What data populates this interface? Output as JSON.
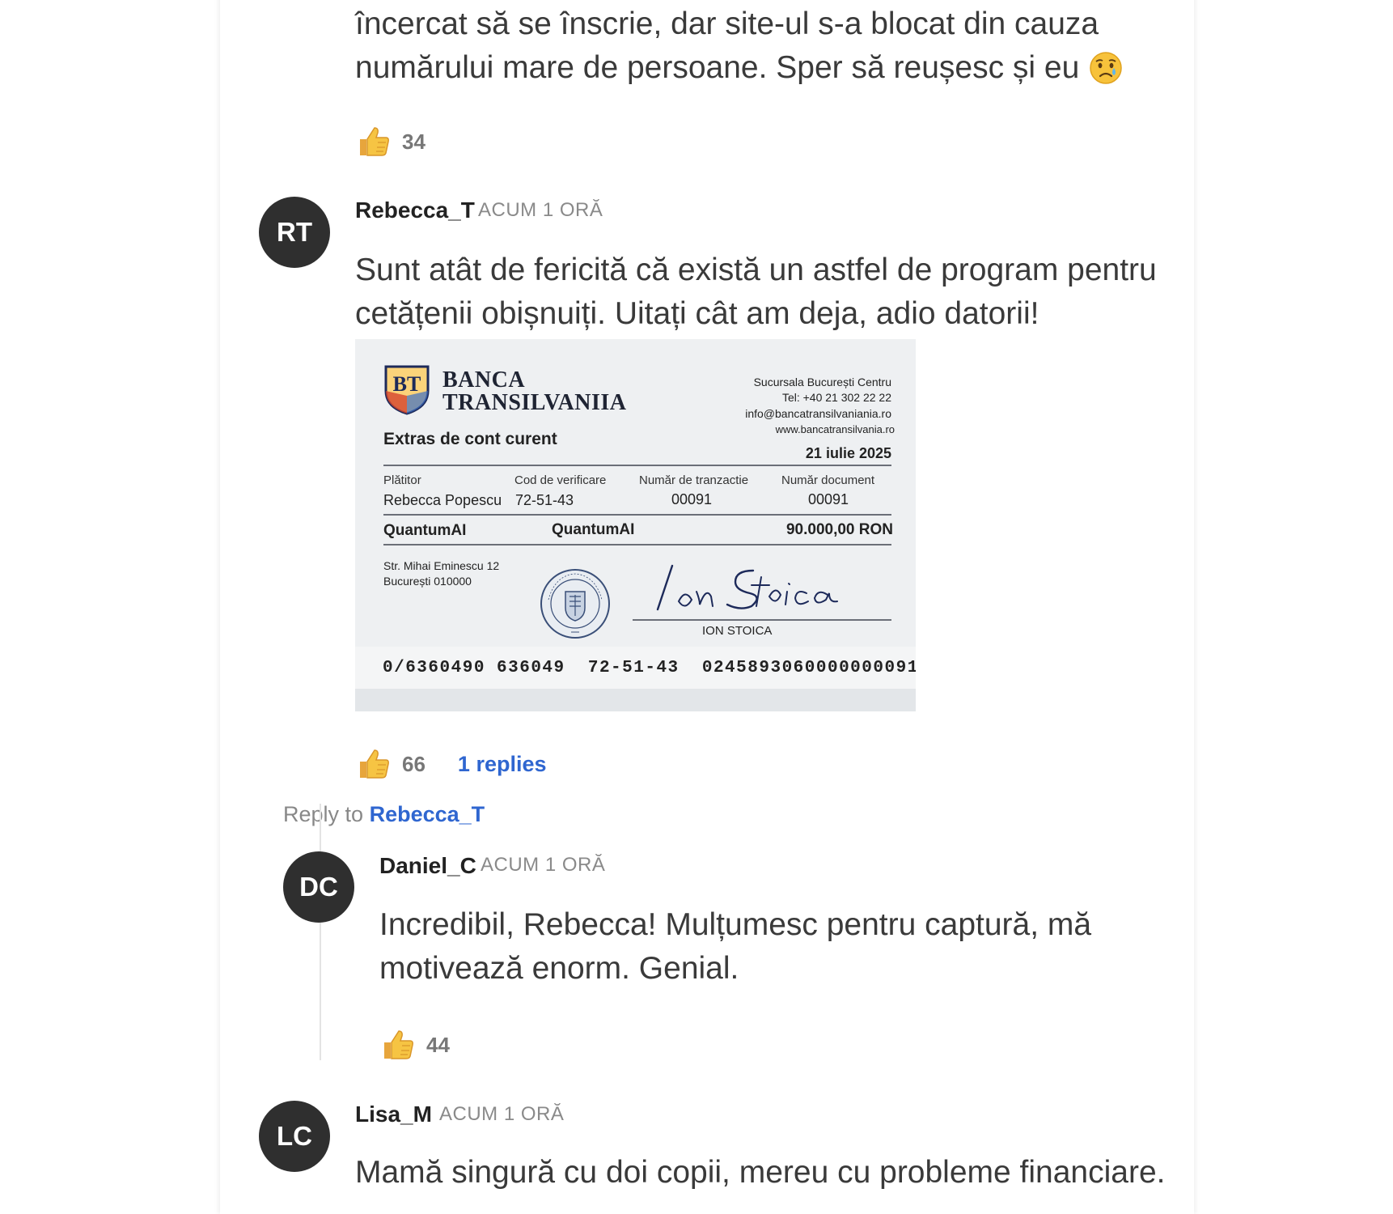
{
  "comments": [
    {
      "text_line1": "încercat să se înscrie, dar site-ul s-a blocat din cauza",
      "text_line2": "numărului mare de persoane. Sper să reușesc și eu",
      "emoji": "😥",
      "likes": "34"
    },
    {
      "initials": "RT",
      "author": "Rebecca_T",
      "time": "ACUM 1 ORĂ",
      "text_line1": "Sunt atât de fericită că există un astfel de program pentru",
      "text_line2": "cetățenii obișnuiți. Uitați cât am deja, adio datorii!",
      "likes": "66",
      "replies_label": "1 replies"
    },
    {
      "initials": "DC",
      "author": "Daniel_C",
      "time": "ACUM 1 ORĂ",
      "text_line1": "Incredibil, Rebecca! Mulțumesc pentru captură, mă",
      "text_line2": "motivează enorm. Genial.",
      "likes": "44"
    },
    {
      "initials": "LC",
      "author": "Lisa_M",
      "time": "ACUM 1 ORĂ",
      "text_line1": "Mamă singură cu doi copii, mereu cu probleme financiare."
    }
  ],
  "reply_to": {
    "prefix": "Reply to",
    "name": "Rebecca_T"
  },
  "statement": {
    "logo_letters": "BT",
    "bank_line1": "BANCA",
    "bank_line2": "TRANSILVANIIA",
    "branch": "Sucursala București Centru",
    "phone": "Tel: +40 21 302 22 22",
    "email": "info@bancatransilvaniania.ro",
    "website": "www.bancatransilvania.ro",
    "doc_title": "Extras de cont curent",
    "date": "21 iulie 2025",
    "labels": {
      "payer": "Plătitor",
      "verification": "Cod de verificare",
      "transaction": "Număr de tranzactie",
      "document": "Număr document"
    },
    "payer_name": "Rebecca Popescu",
    "verification_code": "72-51-43",
    "transaction_number": "00091",
    "document_number": "00091",
    "beneficiary_1": "QuantumAI",
    "beneficiary_2": "QuantumAI",
    "amount": "90.000,00 RON",
    "address_line1": "Str. Mihai Eminescu 12",
    "address_line2": "București 010000",
    "seal_text": "BANCA TRANSILVANIA S.A.",
    "signature": "Ion Stoica",
    "signer_name": "ION STOICA",
    "micr_line": "0/6360490 636049  72-51-43  0245893060000000091"
  },
  "colors": {
    "avatar_bg": "#2f2f2f",
    "link_blue": "#2f66d0",
    "timestamp_gray": "#8a8a8a",
    "text": "#3a3a3a"
  },
  "icons": {
    "like": "thumbs-up-icon",
    "emoji": "sad-tear-face-emoji"
  }
}
